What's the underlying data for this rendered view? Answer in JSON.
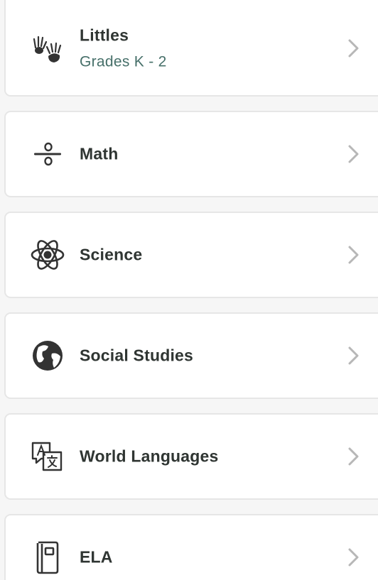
{
  "subjects": [
    {
      "id": "littles",
      "title": "Littles",
      "subtitle": "Grades K - 2",
      "icon": "handprints-icon"
    },
    {
      "id": "math",
      "title": "Math",
      "icon": "fraction-icon"
    },
    {
      "id": "science",
      "title": "Science",
      "icon": "atom-icon"
    },
    {
      "id": "social-studies",
      "title": "Social Studies",
      "icon": "globe-icon"
    },
    {
      "id": "world-languages",
      "title": "World Languages",
      "icon": "translate-icon"
    },
    {
      "id": "ela",
      "title": "ELA",
      "icon": "book-icon"
    }
  ],
  "colors": {
    "title": "#2f3532",
    "subtitle": "#47706a",
    "chevron": "#b7b7b7",
    "icon": "#333333"
  }
}
